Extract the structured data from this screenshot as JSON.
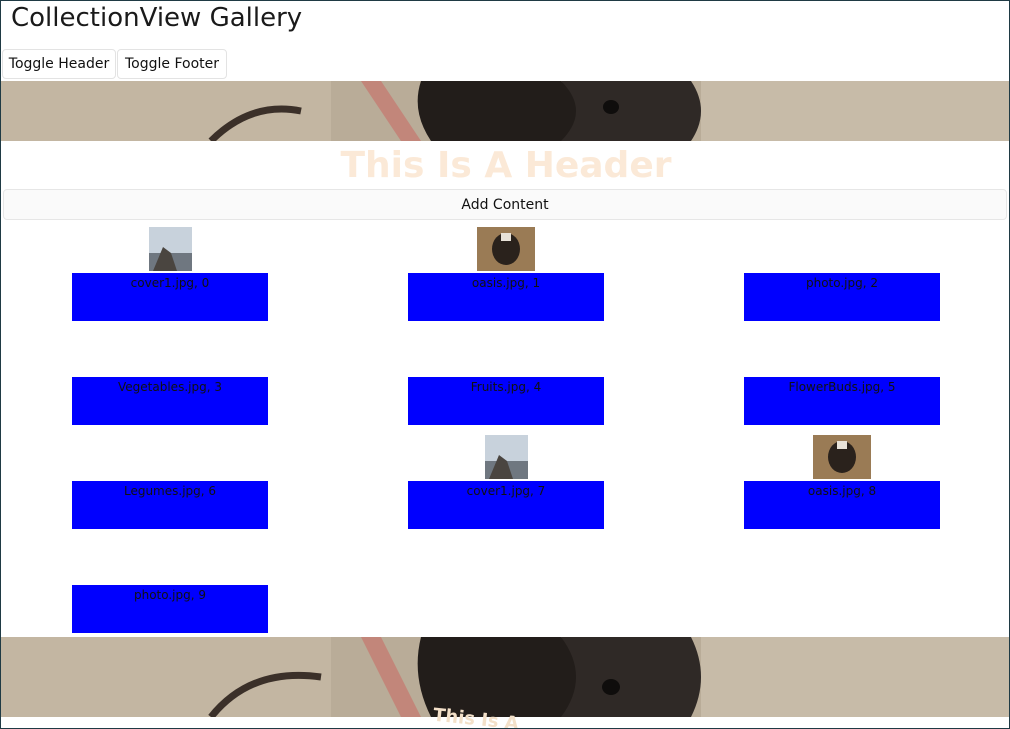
{
  "app": {
    "title": "CollectionView Gallery"
  },
  "toolbar": {
    "toggle_header_label": "Toggle Header",
    "toggle_footer_label": "Toggle Footer"
  },
  "header": {
    "text": "This Is A Header",
    "text_color": "#fbe9d7"
  },
  "add_content_label": "Add Content",
  "footer": {
    "text": "This Is A"
  },
  "items": [
    {
      "label": "cover1.jpg, 0",
      "image": "cover1-thumb"
    },
    {
      "label": "oasis.jpg, 1",
      "image": "oasis-thumb"
    },
    {
      "label": "photo.jpg, 2",
      "image": ""
    },
    {
      "label": "Vegetables.jpg, 3",
      "image": ""
    },
    {
      "label": "Fruits.jpg, 4",
      "image": ""
    },
    {
      "label": "FlowerBuds.jpg, 5",
      "image": ""
    },
    {
      "label": "Legumes.jpg, 6",
      "image": ""
    },
    {
      "label": "cover1.jpg, 7",
      "image": "cover1-thumb"
    },
    {
      "label": "oasis.jpg, 8",
      "image": "oasis-thumb"
    },
    {
      "label": "photo.jpg, 9",
      "image": ""
    }
  ],
  "colors": {
    "item_background": "#0000ff",
    "banner_base": "#b7aa96"
  }
}
